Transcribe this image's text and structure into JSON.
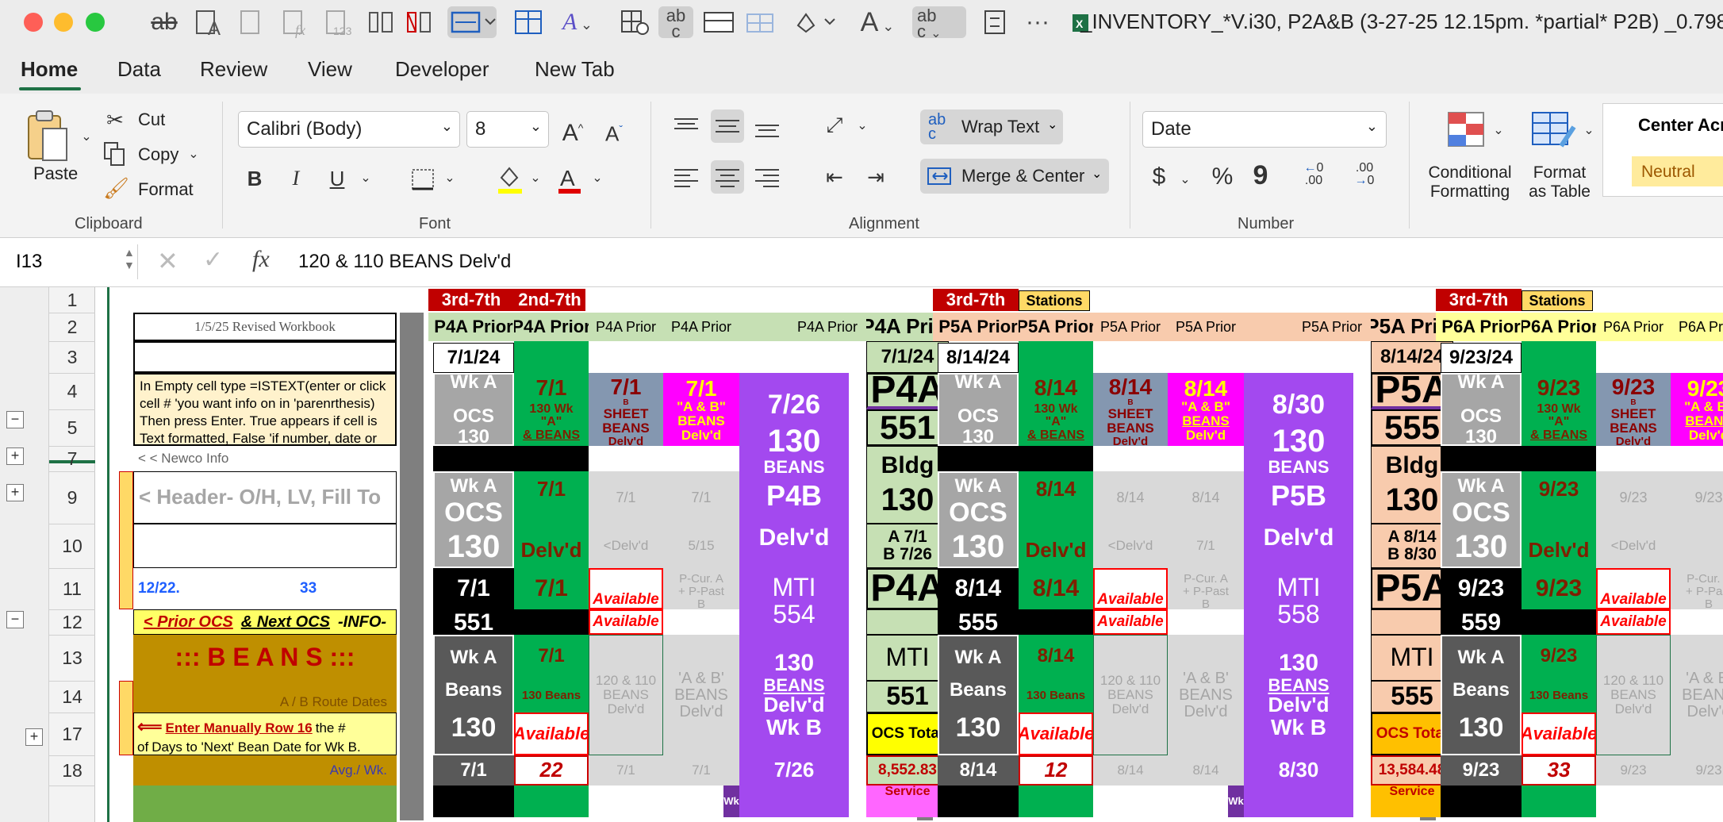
{
  "window": {
    "title": "_INVENTORY_*V.i30, P2A&B (3-27-25 12.15pm. *partial* P2B) _0.798"
  },
  "tabs": [
    "Home",
    "Data",
    "Review",
    "View",
    "Developer",
    "New Tab"
  ],
  "ribbon": {
    "clipboard": {
      "paste": "Paste",
      "cut": "Cut",
      "copy": "Copy",
      "format": "Format",
      "group": "Clipboard"
    },
    "font": {
      "name": "Calibri (Body)",
      "size": "8",
      "bold": "B",
      "italic": "I",
      "underline": "U",
      "group": "Font"
    },
    "alignment": {
      "wrap": "Wrap Text",
      "merge": "Merge & Center",
      "group": "Alignment"
    },
    "number": {
      "format": "Date",
      "currency": "$",
      "percent": "%",
      "comma": "9",
      "group": "Number"
    },
    "styles": {
      "conditional": [
        "Conditional",
        "Formatting"
      ],
      "table": [
        "Format",
        "as Table"
      ],
      "center": "Center Acro",
      "neutral": "Neutral"
    }
  },
  "formula_bar": {
    "cell": "I13",
    "fx": "fx",
    "value": "120 & 110 BEANS  Delv'd"
  },
  "rows": [
    "1",
    "2",
    "3",
    "4",
    "5",
    "7",
    "9",
    "10",
    "11",
    "12",
    "13",
    "14",
    "17",
    "18"
  ],
  "notes": {
    "revised": "1/5/25   Revised Workbook",
    "istext": "In Empty cell type =ISTEXT(enter or click cell # 'you want info on in 'parenrthesis) Then press Enter. True appears if cell is Text formatted, False 'if number, date or",
    "newco": "< < Newco Info",
    "header": "< Header- O/H, LV, Fill To",
    "date12": "12/22.",
    "num33": "33",
    "prior_next": [
      "< Prior OCS",
      "& Next OCS",
      "-INFO-"
    ],
    "beans": ":::  B  E  A  N  S :::",
    "route": "A / B  Route Dates",
    "manual": [
      "⟸",
      "Enter Manually Row 16",
      "the # of",
      "Days to 'Next' Bean Date for Wk B."
    ],
    "avg": "Avg./ Wk."
  },
  "common": {
    "rank": "3rd-7th",
    "rank2": "2nd-7th",
    "stations": "Stations",
    "wka": "Wk A",
    "ocs": "OCS",
    "n130": "130",
    "beans": "Beans",
    "delvd": "Delv'd",
    "available": "Available",
    "mti": "MTI",
    "bldg": "Bldg",
    "ocs_total": "OCS Total",
    "service": "Service",
    "n130wk": "130 Wk",
    "a_ocs": "\"A\"",
    "ocs_u": "OCS",
    "and_beans": "& BEANS",
    "and_beans2": "&",
    "beans_u": "BEANS",
    "b_ch": "B",
    "sheet": "SHEET",
    "beans_cap": "BEANS",
    "ab_beans": "\"A & B\"",
    "delvd_lt": "<Delv'd",
    "pcur": "P-Cur. A",
    "ppast": "+ P-Past",
    "b_small": "B",
    "n120": "120 & 110",
    "beans_small": "BEANS",
    "ab_grey": "'A & B'",
    "n130beans": "130 Beans",
    "wkb": "Wk B",
    "prior": "P4A Prior",
    "wk": "Wk"
  },
  "blocks": [
    {
      "prior": "P4A Prior",
      "start": "7/1/24",
      "d1": "7/1",
      "d2": "7/26",
      "code": "P4A",
      "num": "551",
      "bldg": "130",
      "ab": [
        "A 7/1",
        "B 7/26"
      ],
      "mti": "554",
      "ocsnum": "551",
      "grey_a": "5/15",
      "avg": "22",
      "total": "8,552.83",
      "sub": "P4B"
    },
    {
      "prior": "P5A Prior",
      "start": "8/14/24",
      "d1": "8/14",
      "d2": "8/30",
      "code": "P5A",
      "num": "555",
      "bldg": "130",
      "ab": [
        "A 8/14",
        "B 8/30"
      ],
      "mti": "558",
      "ocsnum": "555",
      "grey_a": "7/1",
      "avg": "12",
      "total": "13,584.48",
      "sub": "P5B"
    },
    {
      "prior": "P6A Prior",
      "start": "9/23/24",
      "d1": "9/23",
      "d2": "",
      "code": "P6A",
      "num": "559",
      "bldg": "",
      "ab": [],
      "mti": "",
      "ocsnum": "559",
      "grey_a": "",
      "avg": "33",
      "total": "",
      "sub": ""
    }
  ],
  "colors": {
    "green": "#00b050",
    "purple": "#a349ef",
    "magenta": "#ff00ff",
    "slate": "#8497b0",
    "lightgreen": "#c6e0b4",
    "peach": "#f8cbad",
    "yellowpale": "#ffff99",
    "gold": "#bf8f00"
  }
}
